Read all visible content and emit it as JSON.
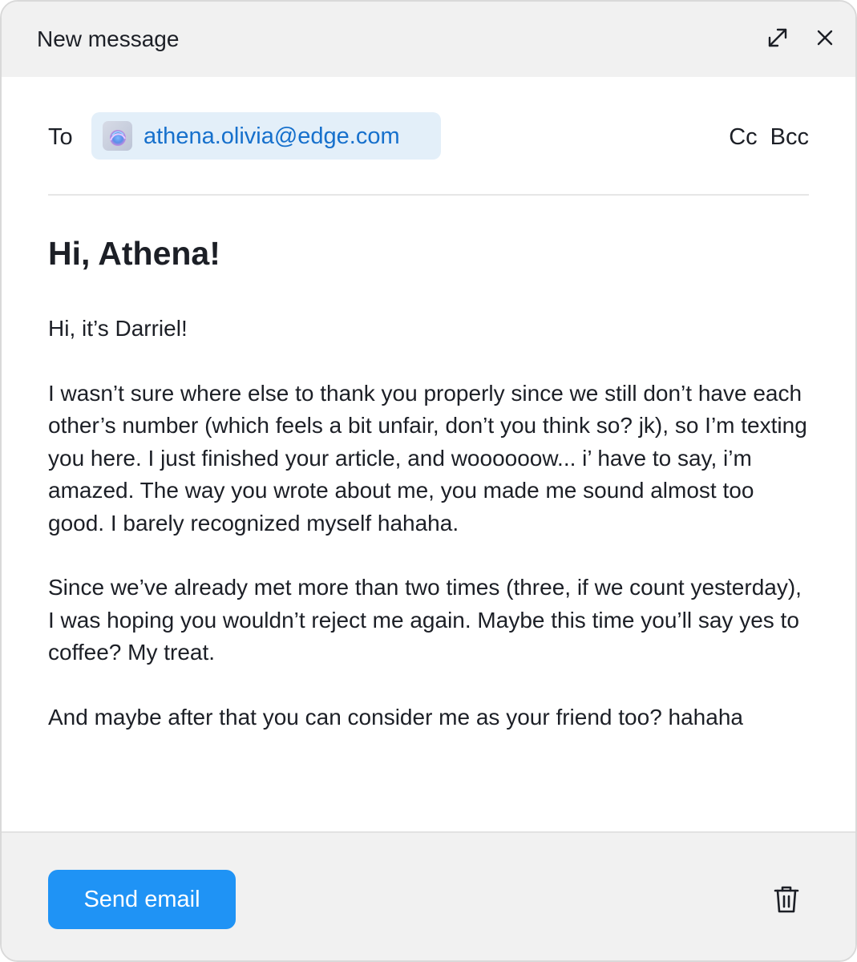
{
  "window": {
    "title": "New message"
  },
  "titlebar_icons": {
    "expand": "expand-icon",
    "close": "close-icon"
  },
  "recipients": {
    "to_label": "To",
    "email": "athena.olivia@edge.com",
    "cc_label": "Cc",
    "bcc_label": "Bcc"
  },
  "message": {
    "greeting": "Hi, Athena!",
    "paragraphs": [
      "Hi, it’s Darriel!",
      "I wasn’t sure where else to thank you properly since we still don’t have each other’s number (which feels a bit unfair, don’t you think so? jk), so I’m texting you here. I just finished your article, and woooooow... i’ have to say,  i’m amazed. The way you wrote about me, you made me sound almost too good. I barely recognized myself hahaha.",
      "Since we’ve already met more than two times (three, if we count yesterday), I was hoping you wouldn’t reject me again. Maybe this time you’ll say yes to coffee? My treat.",
      "And maybe after that you can consider me as your friend too? hahaha"
    ]
  },
  "footer": {
    "send_label": "Send email",
    "delete_icon": "trash-icon"
  },
  "colors": {
    "accent": "#1f93f5",
    "chip_background": "#e3eff9",
    "chip_text": "#1670cc",
    "header_background": "#f1f1f1",
    "text": "#1c1f26"
  }
}
